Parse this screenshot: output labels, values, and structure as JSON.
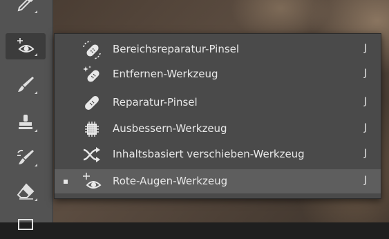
{
  "menu": {
    "items": [
      {
        "label": "Bereichsreparatur-Pinsel",
        "shortcut": "J",
        "icon": "spot-healing-brush-icon",
        "selected": false
      },
      {
        "label": "Entfernen-Werkzeug",
        "shortcut": "J",
        "icon": "remove-tool-icon",
        "selected": false
      },
      {
        "label": "Reparatur-Pinsel",
        "shortcut": "J",
        "icon": "healing-brush-icon",
        "selected": false
      },
      {
        "label": "Ausbessern-Werkzeug",
        "shortcut": "J",
        "icon": "patch-tool-icon",
        "selected": false
      },
      {
        "label": "Inhaltsbasiert verschieben-Werkzeug",
        "shortcut": "J",
        "icon": "content-aware-move-icon",
        "selected": false
      },
      {
        "label": "Rote-Augen-Werkzeug",
        "shortcut": "J",
        "icon": "red-eye-tool-icon",
        "selected": true
      }
    ]
  },
  "toolbar": {
    "tools": [
      "eyedropper-icon",
      "red-eye-tool-icon",
      "brush-icon",
      "stamp-icon",
      "history-brush-icon",
      "eraser-icon"
    ]
  },
  "colors": {
    "panel": "#535353",
    "menu_bg": "#4a4a4a",
    "menu_selected": "#5e5e5e",
    "text": "#e8e8e8"
  }
}
